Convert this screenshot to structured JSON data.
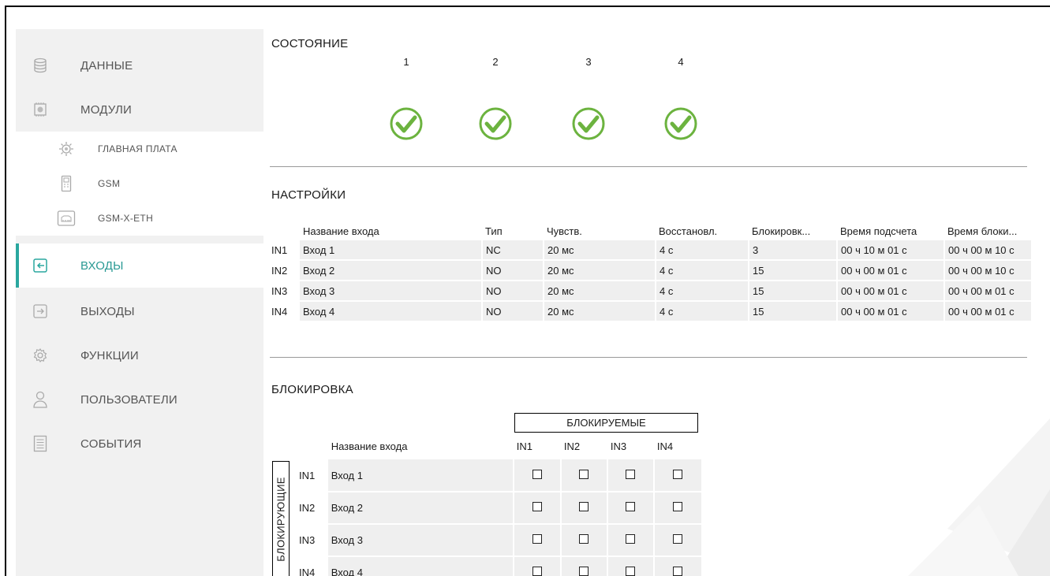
{
  "sidebar": {
    "items": [
      {
        "label": "ДАННЫЕ",
        "icon": "database-icon"
      },
      {
        "label": "МОДУЛИ",
        "icon": "module-icon"
      },
      {
        "label": "ВХОДЫ",
        "icon": "input-icon",
        "active": true
      },
      {
        "label": "ВЫХОДЫ",
        "icon": "output-icon"
      },
      {
        "label": "ФУНКЦИИ",
        "icon": "gear-icon"
      },
      {
        "label": "ПОЛЬЗОВАТЕЛИ",
        "icon": "user-icon"
      },
      {
        "label": "СОБЫТИЯ",
        "icon": "events-icon"
      }
    ],
    "subitems": [
      {
        "label": "ГЛАВНАЯ ПЛАТА",
        "icon": "mainboard-icon"
      },
      {
        "label": "GSM",
        "icon": "gsm-icon"
      },
      {
        "label": "GSM-X-ETH",
        "icon": "ethernet-icon"
      }
    ]
  },
  "status": {
    "title": "СОСТОЯНИЕ",
    "columns": [
      "1",
      "2",
      "3",
      "4"
    ]
  },
  "settings": {
    "title": "НАСТРОЙКИ",
    "headers": [
      "Название входа",
      "Тип",
      "Чувств.",
      "Восстановл.",
      "Блокировк...",
      "Время подсчета",
      "Время блоки..."
    ],
    "rows": [
      {
        "id": "IN1",
        "cells": [
          "Вход 1",
          "NC",
          "20 мс",
          "4 с",
          "3",
          "00 ч 10 м 01 с",
          "00 ч 00 м 10 с"
        ]
      },
      {
        "id": "IN2",
        "cells": [
          "Вход 2",
          "NO",
          "20 мс",
          "4 с",
          "15",
          "00 ч 00 м 01 с",
          "00 ч 00 м 10 с"
        ]
      },
      {
        "id": "IN3",
        "cells": [
          "Вход 3",
          "NO",
          "20 мс",
          "4 с",
          "15",
          "00 ч 00 м 01 с",
          "00 ч 00 м 01 с"
        ]
      },
      {
        "id": "IN4",
        "cells": [
          "Вход 4",
          "NO",
          "20 мс",
          "4 с",
          "15",
          "00 ч 00 м 01 с",
          "00 ч 00 м 01 с"
        ]
      }
    ]
  },
  "lock": {
    "title": "БЛОКИРОВКА",
    "blocked_label": "БЛОКИРУЕМЫЕ",
    "blocking_label": "БЛОКИРУЮЩИЕ",
    "name_header": "Название входа",
    "columns": [
      "IN1",
      "IN2",
      "IN3",
      "IN4"
    ],
    "rows": [
      {
        "id": "IN1",
        "name": "Вход 1"
      },
      {
        "id": "IN2",
        "name": "Вход 2"
      },
      {
        "id": "IN3",
        "name": "Вход 3"
      },
      {
        "id": "IN4",
        "name": "Вход 4"
      }
    ]
  },
  "colors": {
    "accent": "#2aa79f",
    "check": "#6cb33f",
    "sidebar_bg": "#f1f1f1"
  }
}
